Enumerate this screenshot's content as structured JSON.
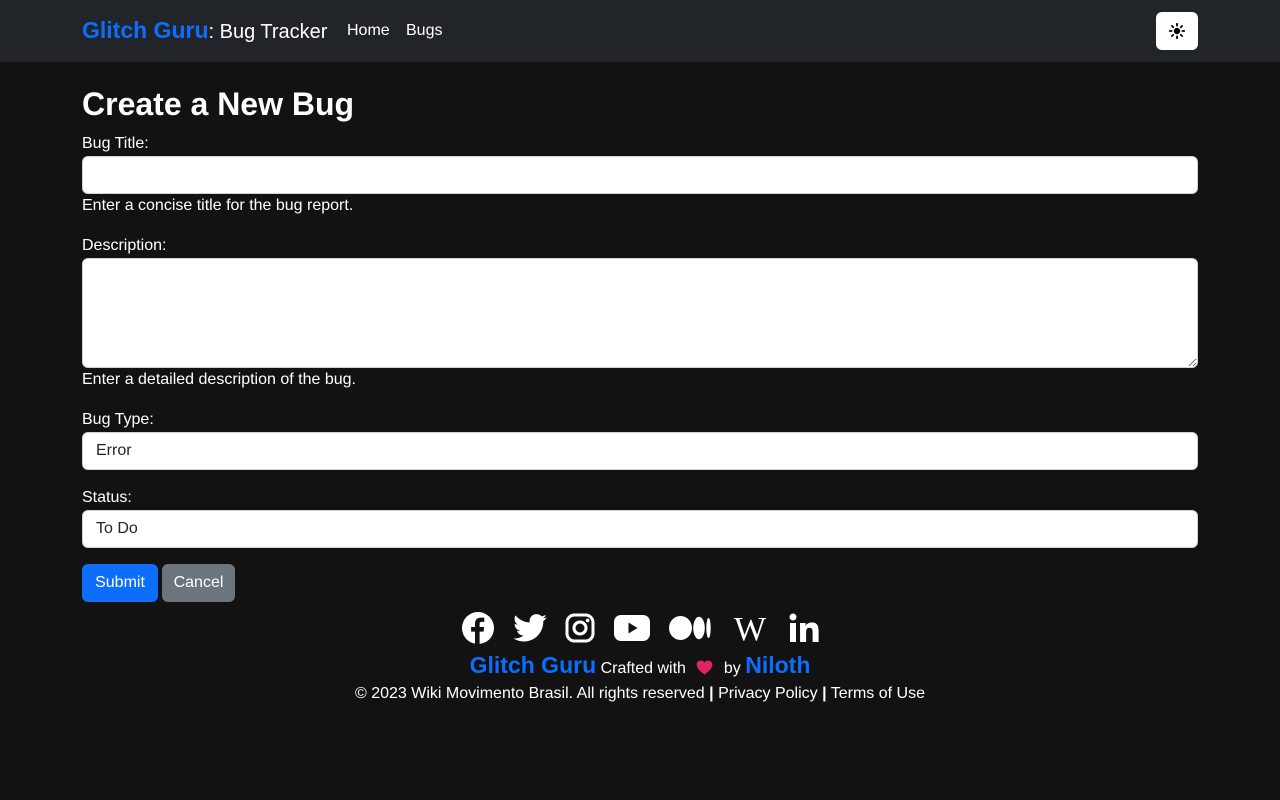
{
  "navbar": {
    "brand_name": "Glitch Guru",
    "brand_suffix": ": Bug Tracker",
    "links": [
      "Home",
      "Bugs"
    ],
    "theme_icon": "sun-icon"
  },
  "form": {
    "title": "Create a New Bug",
    "bug_title": {
      "label": "Bug Title:",
      "value": "",
      "help": "Enter a concise title for the bug report."
    },
    "description": {
      "label": "Description:",
      "value": "",
      "help": "Enter a detailed description of the bug."
    },
    "bug_type": {
      "label": "Bug Type:",
      "selected": "Error"
    },
    "status": {
      "label": "Status:",
      "selected": "To Do"
    },
    "submit_label": "Submit",
    "cancel_label": "Cancel"
  },
  "footer": {
    "social_icons": [
      "facebook-icon",
      "twitter-icon",
      "instagram-icon",
      "youtube-icon",
      "medium-icon",
      "wikipedia-icon",
      "linkedin-icon"
    ],
    "brand_name": "Glitch Guru",
    "crafted_text": "Crafted with",
    "by_text": "by",
    "author": "Niloth",
    "copyright": "© 2023 Wiki Movimento Brasil. All rights reserved",
    "separator": "|",
    "privacy": "Privacy Policy",
    "terms": "Terms of Use"
  },
  "colors": {
    "background": "#121212",
    "navbar": "#212529",
    "accent": "#0d6efd",
    "secondary": "#6c757d",
    "heart": "#e0245e"
  }
}
